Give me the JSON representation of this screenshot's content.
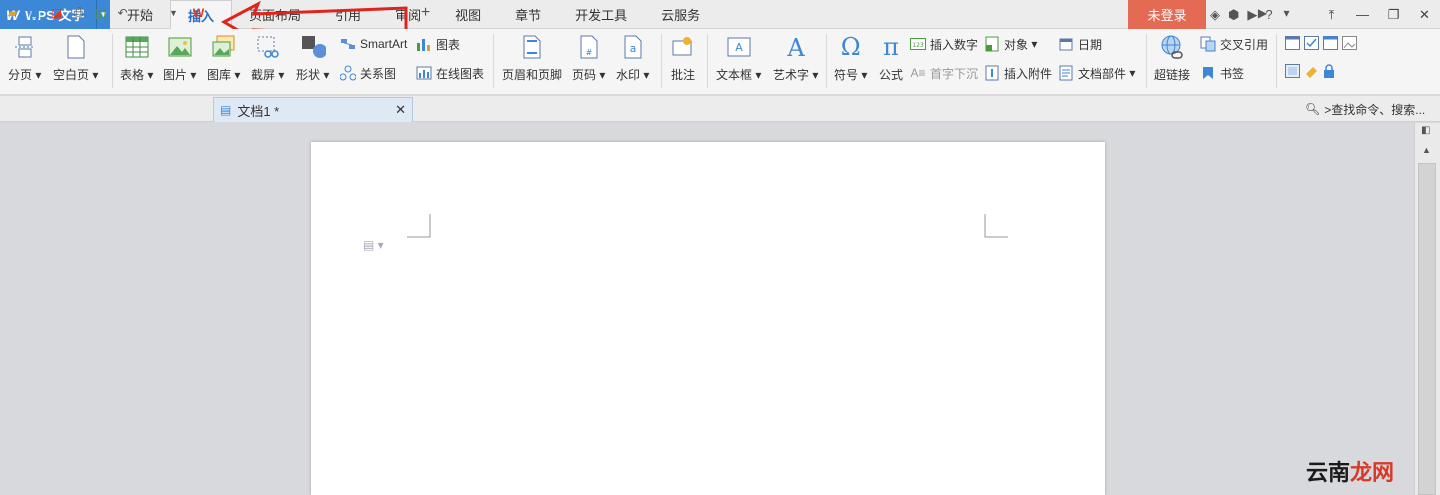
{
  "app": {
    "brand": "WPS 文字",
    "logo": "W"
  },
  "tabs": [
    {
      "label": "开始",
      "active": false
    },
    {
      "label": "插入",
      "active": true
    },
    {
      "label": "页面布局",
      "active": false
    },
    {
      "label": "引用",
      "active": false
    },
    {
      "label": "审阅",
      "active": false
    },
    {
      "label": "视图",
      "active": false
    },
    {
      "label": "章节",
      "active": false
    },
    {
      "label": "开发工具",
      "active": false
    },
    {
      "label": "云服务",
      "active": false
    }
  ],
  "account": {
    "login_label": "未登录"
  },
  "ribbon": {
    "page_break": "分页",
    "blank_page": "空白页",
    "table": "表格",
    "picture": "图片",
    "gallery": "图库",
    "screenshot": "截屏",
    "shape": "形状",
    "smartart": "SmartArt",
    "chart": "图表",
    "relation": "关系图",
    "online_chart": "在线图表",
    "header_footer": "页眉和页脚",
    "page_num": "页码",
    "watermark": "水印",
    "comment": "批注",
    "textbox": "文本框",
    "wordart": "艺术字",
    "symbol": "符号",
    "formula": "公式",
    "insert_number": "插入数字",
    "drop_cap": "首字下沉",
    "object": "对象",
    "attachment": "插入附件",
    "date": "日期",
    "doc_parts": "文档部件",
    "hyperlink": "超链接",
    "cross_ref": "交叉引用",
    "bookmark": "书签"
  },
  "document": {
    "tab_title": "文档1 *"
  },
  "search": {
    "placeholder": ">查找命令、搜索..."
  },
  "watermark_text": {
    "part1": "云南",
    "part2": "龙网"
  },
  "colors": {
    "accent": "#3c87d6",
    "login_bg": "#e56a53",
    "arrow": "#e0231b"
  }
}
